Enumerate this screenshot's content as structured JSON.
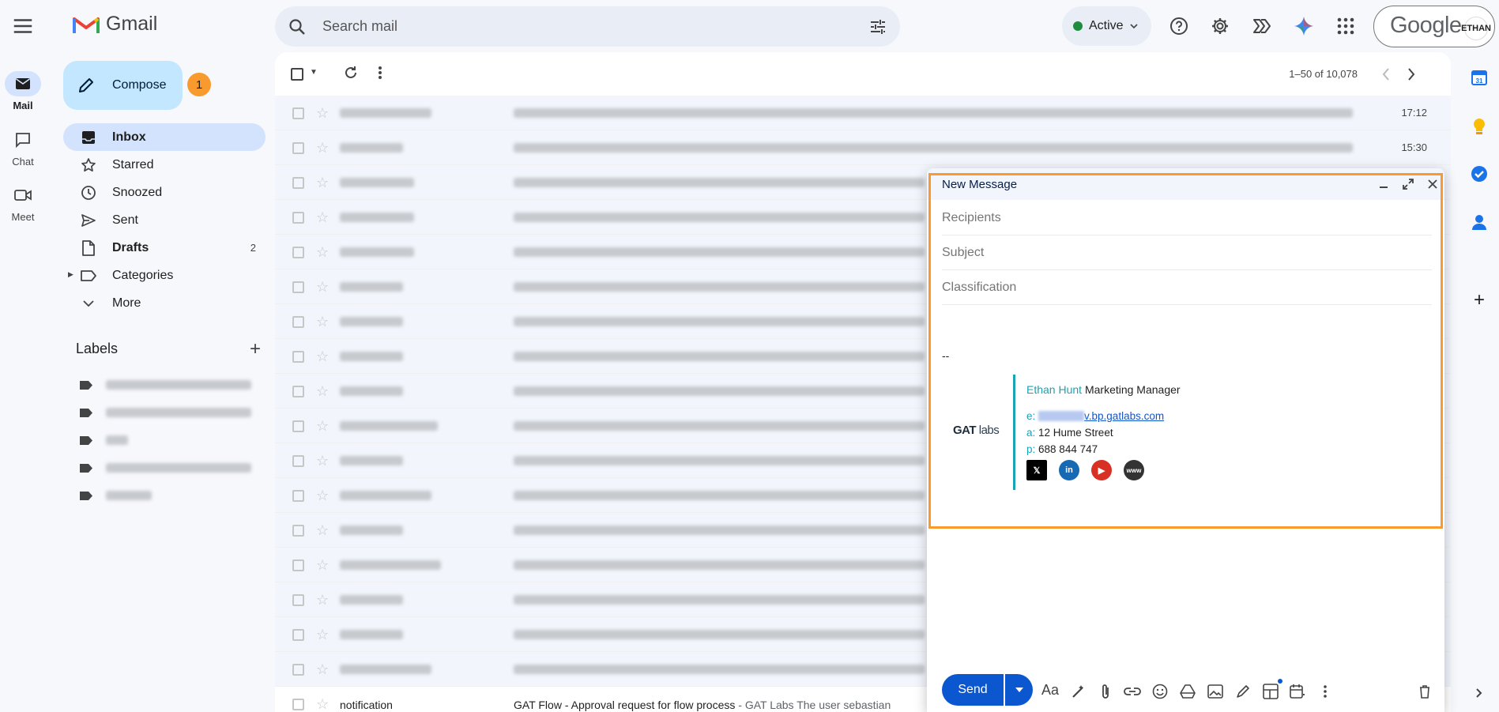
{
  "app": {
    "name": "Gmail"
  },
  "rail": {
    "items": [
      {
        "label": "Mail"
      },
      {
        "label": "Chat"
      },
      {
        "label": "Meet"
      }
    ]
  },
  "search": {
    "placeholder": "Search mail"
  },
  "status": {
    "label": "Active"
  },
  "account": {
    "brand": "Google",
    "avatar_text": "ETHAN"
  },
  "compose": {
    "label": "Compose",
    "badge": "1"
  },
  "nav": [
    {
      "label": "Inbox",
      "count": ""
    },
    {
      "label": "Starred",
      "count": ""
    },
    {
      "label": "Snoozed",
      "count": ""
    },
    {
      "label": "Sent",
      "count": ""
    },
    {
      "label": "Drafts",
      "count": "2"
    },
    {
      "label": "Categories",
      "count": ""
    },
    {
      "label": "More",
      "count": ""
    }
  ],
  "labels": {
    "title": "Labels"
  },
  "list": {
    "pager": "1–50 of 10,078",
    "times": [
      "17:12",
      "15:30"
    ],
    "last_row": {
      "sender": "notification",
      "subject": "GAT Flow - Approval request for flow process",
      "snippet": " - GAT Labs The user sebastian"
    }
  },
  "compose_window": {
    "title": "New Message",
    "recipients_placeholder": "Recipients",
    "subject_placeholder": "Subject",
    "classification_placeholder": "Classification",
    "separator": "--",
    "signature": {
      "logo": "GAT",
      "logo_suffix": "labs",
      "name": "Ethan Hunt",
      "role": "Marketing Manager",
      "email_label": "e:",
      "email_visible": "v.bp.gatlabs.com",
      "address_label": "a:",
      "address": "12 Hume Street",
      "phone_label": "p:",
      "phone": "688 844 747",
      "social": [
        "x",
        "in",
        "youtube",
        "www"
      ]
    },
    "send_label": "Send"
  },
  "colors": {
    "accent": "#0b57d0",
    "highlight": "#f89a2d",
    "signature_accent": "#1aa3b5",
    "active_nav": "#d3e3fd",
    "compose_button": "#c2e7ff"
  }
}
